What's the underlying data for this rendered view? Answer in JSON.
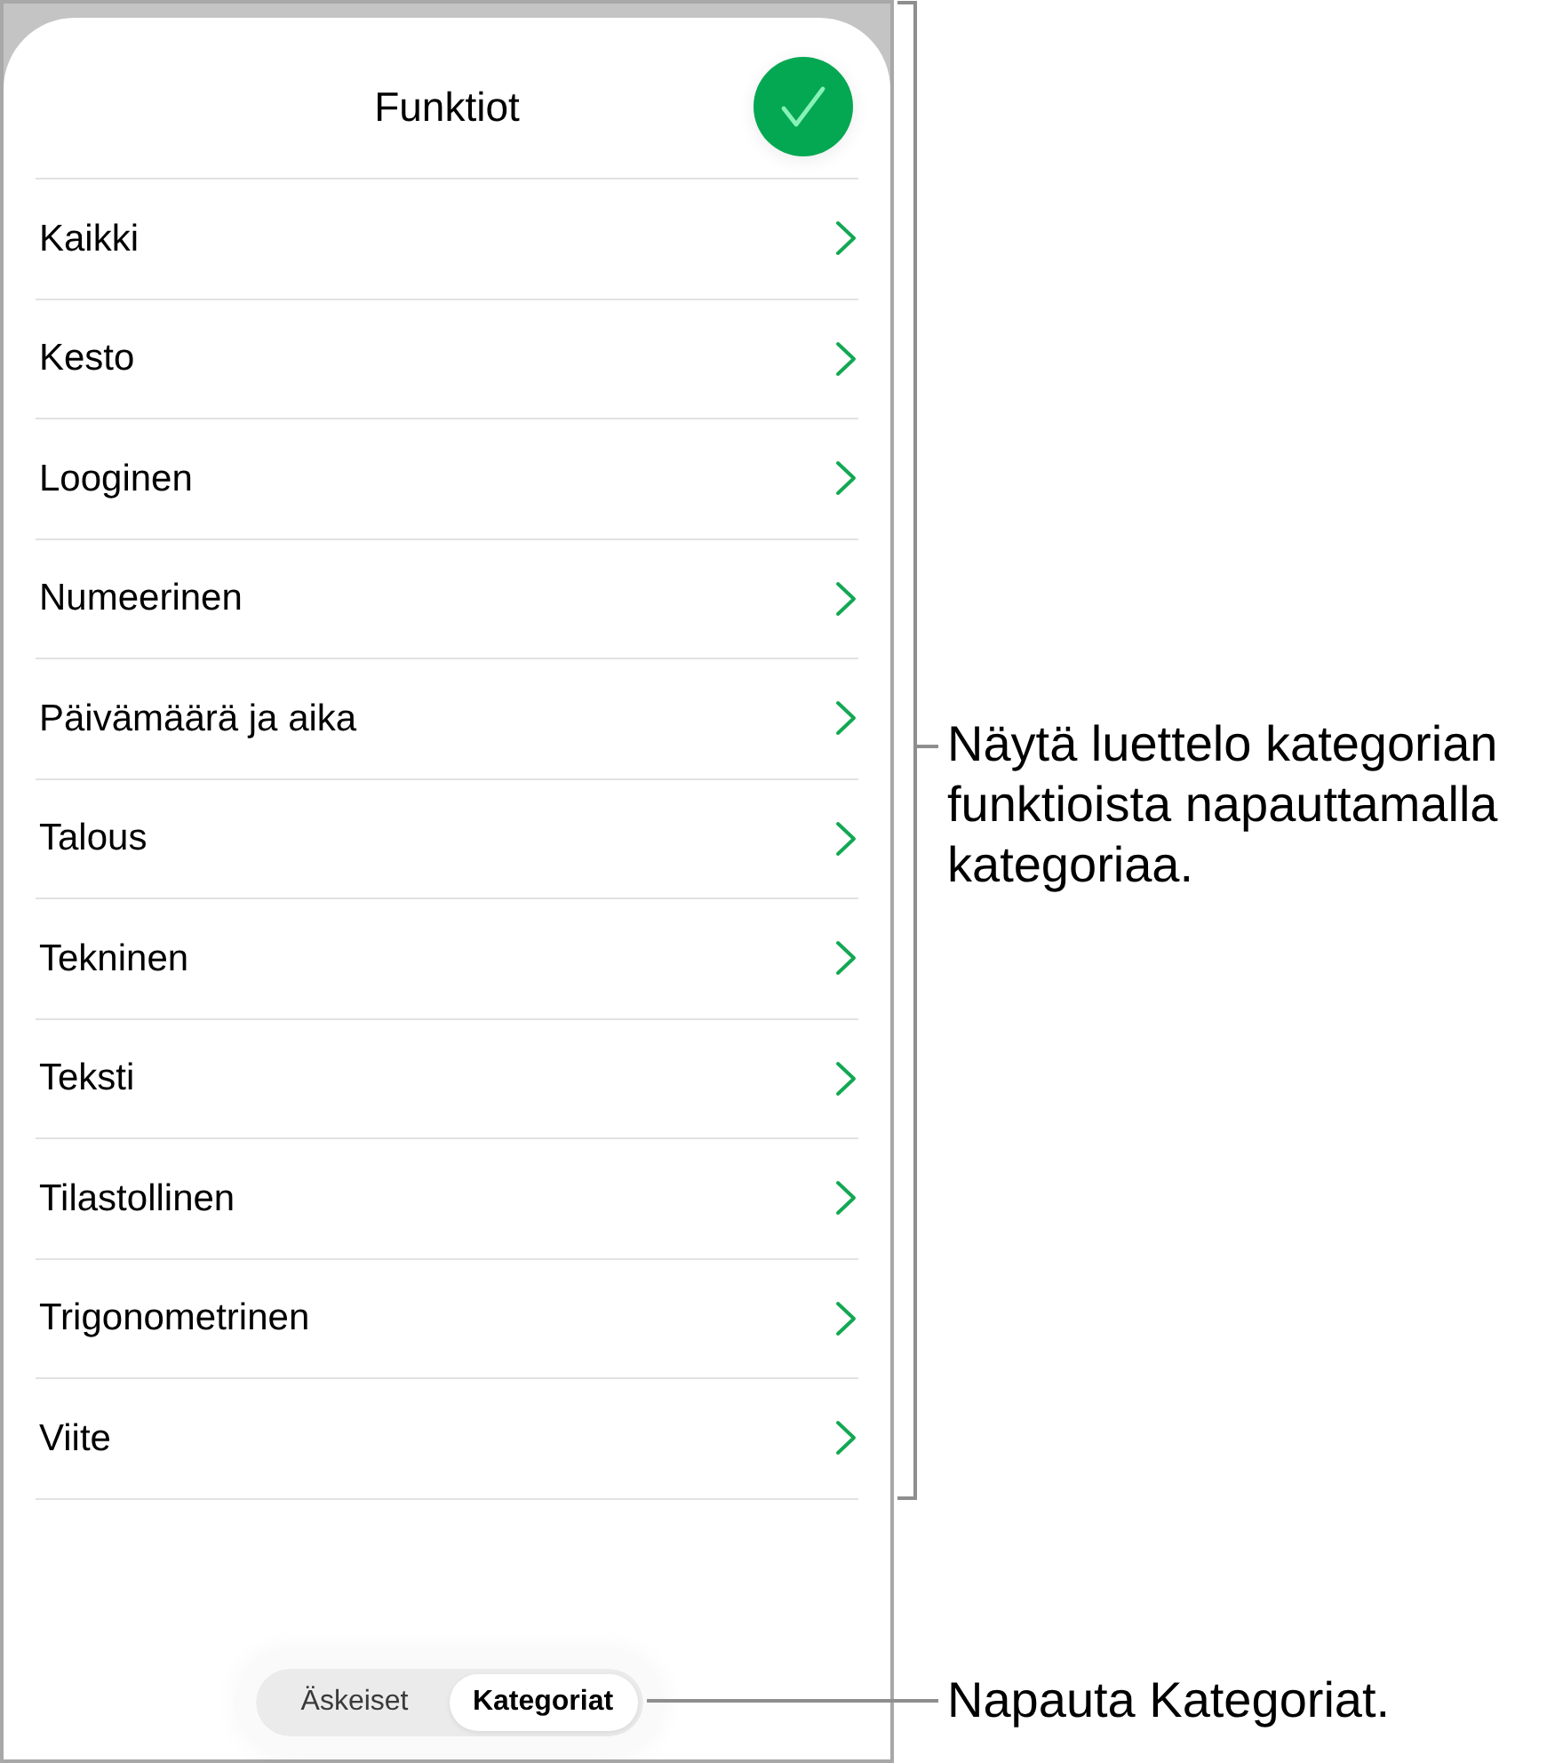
{
  "sheet": {
    "title": "Funktiot",
    "categories": [
      {
        "label": "Kaikki"
      },
      {
        "label": "Kesto"
      },
      {
        "label": "Looginen"
      },
      {
        "label": "Numeerinen"
      },
      {
        "label": "Päivämäärä ja aika"
      },
      {
        "label": "Talous"
      },
      {
        "label": "Tekninen"
      },
      {
        "label": "Teksti"
      },
      {
        "label": "Tilastollinen"
      },
      {
        "label": "Trigonometrinen"
      },
      {
        "label": "Viite"
      }
    ],
    "segments": [
      {
        "label": "Äskeiset",
        "selected": false
      },
      {
        "label": "Kategoriat",
        "selected": true
      }
    ]
  },
  "callouts": [
    {
      "text": "Näytä luettelo kategorian funktioista napauttamalla kategoriaa."
    },
    {
      "text": "Napauta Kategoriat."
    }
  ]
}
